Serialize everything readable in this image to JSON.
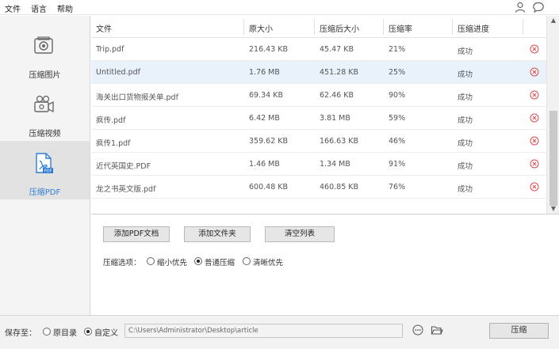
{
  "menu": {
    "file": "文件",
    "language": "语言",
    "help": "帮助"
  },
  "sidebar": {
    "items": [
      {
        "label": "压缩图片",
        "icon": "image-icon"
      },
      {
        "label": "压缩视频",
        "icon": "video-camera-icon"
      },
      {
        "label": "压缩PDF",
        "icon": "pdf-file-icon",
        "active": true
      }
    ]
  },
  "table": {
    "headers": [
      "文件",
      "原大小",
      "压缩后大小",
      "压缩率",
      "压缩进度"
    ],
    "rows": [
      {
        "name": "Trip.pdf",
        "size": "216.43 KB",
        "compressed": "45.47 KB",
        "ratio": "21%",
        "status": "成功"
      },
      {
        "name": "Untitled.pdf",
        "size": "1.76 MB",
        "compressed": "451.28 KB",
        "ratio": "25%",
        "status": "成功"
      },
      {
        "name": "海关出口货物报关单.pdf",
        "size": "69.34 KB",
        "compressed": "62.46 KB",
        "ratio": "90%",
        "status": "成功"
      },
      {
        "name": "疯传.pdf",
        "size": "6.42 MB",
        "compressed": "3.81 MB",
        "ratio": "59%",
        "status": "成功"
      },
      {
        "name": "疯传1.pdf",
        "size": "359.62 KB",
        "compressed": "166.63 KB",
        "ratio": "46%",
        "status": "成功"
      },
      {
        "name": "近代英国史.PDF",
        "size": "1.46 MB",
        "compressed": "1.34 MB",
        "ratio": "91%",
        "status": "成功"
      },
      {
        "name": "龙之书英文版.pdf",
        "size": "600.48 KB",
        "compressed": "460.85 KB",
        "ratio": "76%",
        "status": "成功"
      }
    ]
  },
  "actions": {
    "add_pdf": "添加PDF文档",
    "add_folder": "添加文件夹",
    "clear_list": "清空列表"
  },
  "options": {
    "label": "压缩选项：",
    "choices": [
      "缩小优先",
      "普通压缩",
      "清晰优先"
    ],
    "selected": "普通压缩"
  },
  "footer": {
    "save_to": "保存至：",
    "original_dir": "原目录",
    "custom": "自定义",
    "path": "C:\\Users\\Administrator\\Desktop\\article",
    "compress": "压缩"
  },
  "colors": {
    "accent": "#2f7fd4",
    "delete": "#e04b4b",
    "highlight_row": "#e9f1fb"
  }
}
